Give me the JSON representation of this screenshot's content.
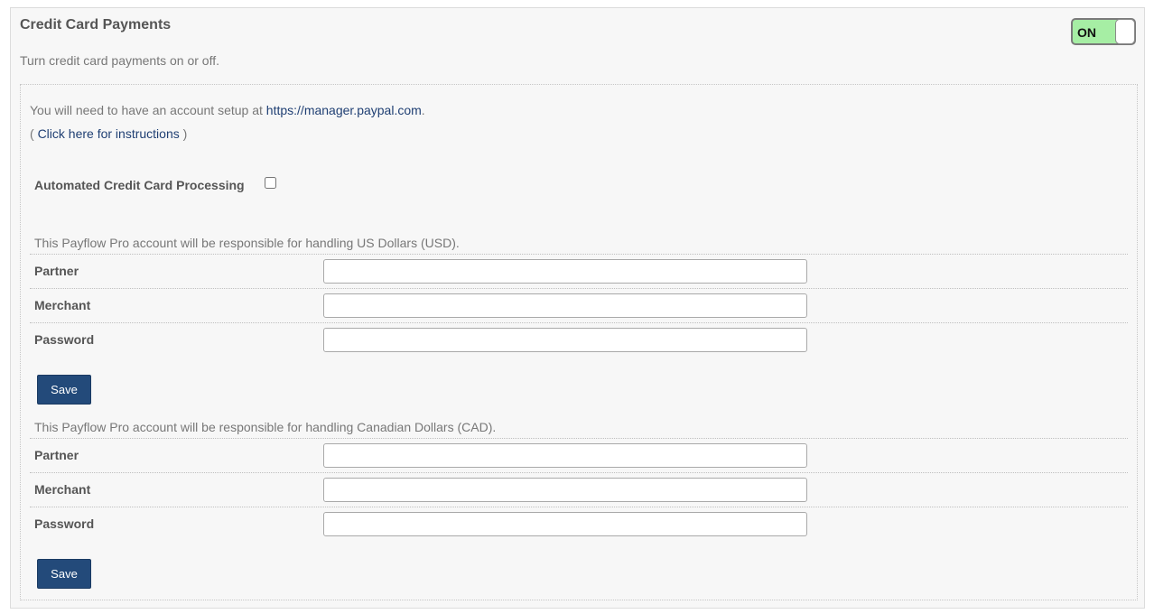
{
  "header": {
    "title": "Credit Card Payments",
    "subtitle": "Turn credit card payments on or off.",
    "toggle_label": "ON"
  },
  "info": {
    "setup_prefix": "You will need to have an account setup at",
    "setup_link": "https://manager.paypal.com",
    "setup_suffix": ".",
    "instructions_open": "(",
    "instructions_link": "Click here for instructions",
    "instructions_close": ")"
  },
  "automated": {
    "label": "Automated Credit Card Processing",
    "checked": false
  },
  "usd": {
    "description": "This Payflow Pro account will be responsible for handling US Dollars (USD).",
    "partner_label": "Partner",
    "partner_value": "",
    "merchant_label": "Merchant",
    "merchant_value": "",
    "password_label": "Password",
    "password_value": "",
    "save_label": "Save"
  },
  "cad": {
    "description": "This Payflow Pro account will be responsible for handling Canadian Dollars (CAD).",
    "partner_label": "Partner",
    "partner_value": "",
    "merchant_label": "Merchant",
    "merchant_value": "",
    "password_label": "Password",
    "password_value": "",
    "save_label": "Save"
  },
  "colors": {
    "toggle_on": "#a6eea4",
    "button": "#234a7a",
    "link": "#1f3f73"
  }
}
